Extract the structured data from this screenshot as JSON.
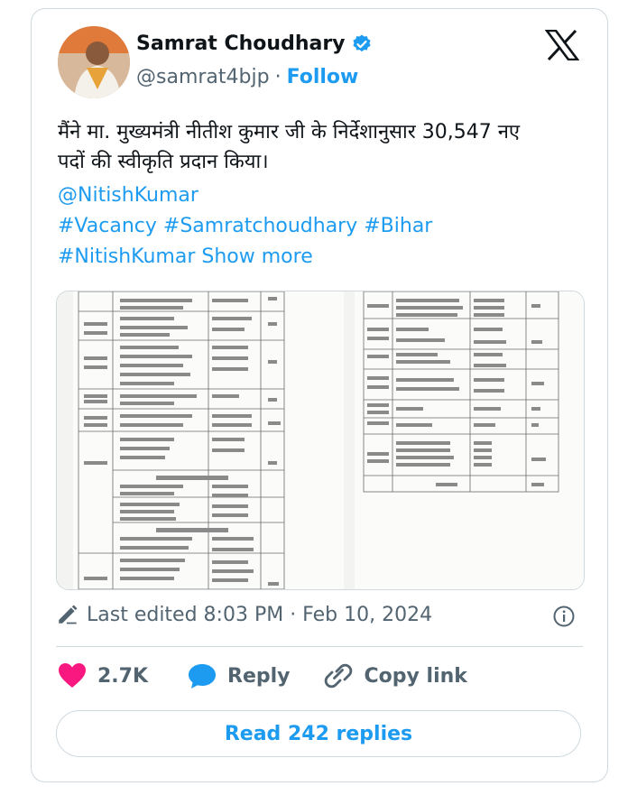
{
  "author": {
    "name": "Samrat Choudhary",
    "handle": "@samrat4bjp",
    "separator": "·",
    "follow_label": "Follow"
  },
  "tweet": {
    "text_line1": "मैंने मा. मुख्यमंत्री नीतीश कुमार जी के निर्देशानुसार 30,547 नए",
    "text_line2": "पदों की स्वीकृति प्रदान किया।",
    "mention": "@NitishKumar",
    "hashtags_line1": "#Vacancy #Samratchoudhary #Bihar",
    "hashtag_last": "#NitishKumar",
    "show_more": "Show more"
  },
  "meta": {
    "edited_text": "Last edited 8:03 PM · Feb 10, 2024"
  },
  "actions": {
    "likes": "2.7K",
    "reply_label": "Reply",
    "copy_label": "Copy link"
  },
  "read_replies": "Read 242 replies",
  "colors": {
    "accent": "#1d9bf0",
    "like": "#f91880",
    "muted": "#536471",
    "border": "#cfd9de"
  },
  "icons": [
    "verified-badge-icon",
    "x-logo-icon",
    "pencil-icon",
    "info-icon",
    "heart-icon",
    "reply-bubble-icon",
    "link-icon"
  ]
}
